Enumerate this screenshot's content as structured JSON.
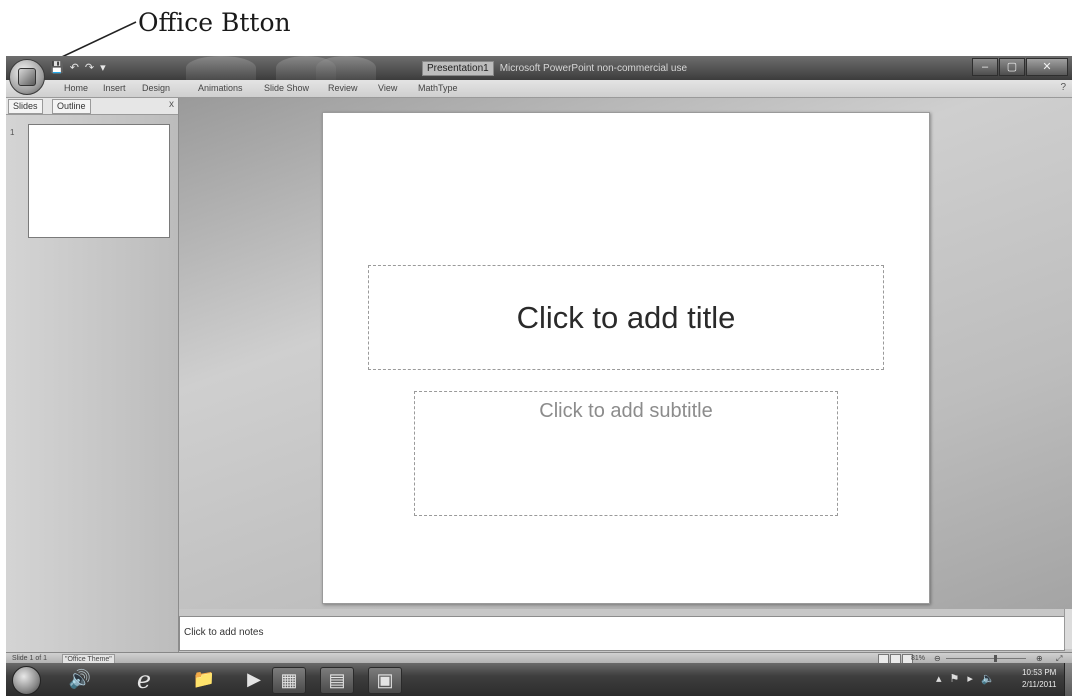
{
  "annotation": {
    "label": "Office Btton"
  },
  "window": {
    "quick_access": [
      "💾",
      "↶",
      "↷",
      "▾"
    ],
    "document_name": "Presentation1",
    "app_name": "Microsoft PowerPoint non-commercial use",
    "controls": {
      "minimize": "–",
      "restore": "▢",
      "close": "✕"
    }
  },
  "ribbon": {
    "tabs": [
      "Home",
      "Insert",
      "Design",
      "Animations",
      "Slide Show",
      "Review",
      "View",
      "MathType"
    ],
    "help": "?"
  },
  "left_pane": {
    "tabs": [
      "Slides",
      "Outline"
    ],
    "close": "x",
    "slide_number": "1"
  },
  "slide": {
    "title_placeholder": "Click to add title",
    "subtitle_placeholder": "Click to add subtitle"
  },
  "notes": {
    "placeholder": "Click to add notes"
  },
  "status_bar": {
    "slide_info": "Slide 1 of 1",
    "theme": "\"Office Theme\"",
    "zoom": "81%",
    "zoom_out": "⊖",
    "zoom_in": "⊕",
    "fit": "⤢"
  },
  "taskbar": {
    "apps": [
      "🔊",
      "e",
      "📁",
      "▶",
      "▦",
      "▤",
      "▣"
    ],
    "tray": [
      "▴",
      "⚑",
      "▸",
      "🔈"
    ],
    "time": "10:53 PM",
    "date": "2/11/2011"
  }
}
